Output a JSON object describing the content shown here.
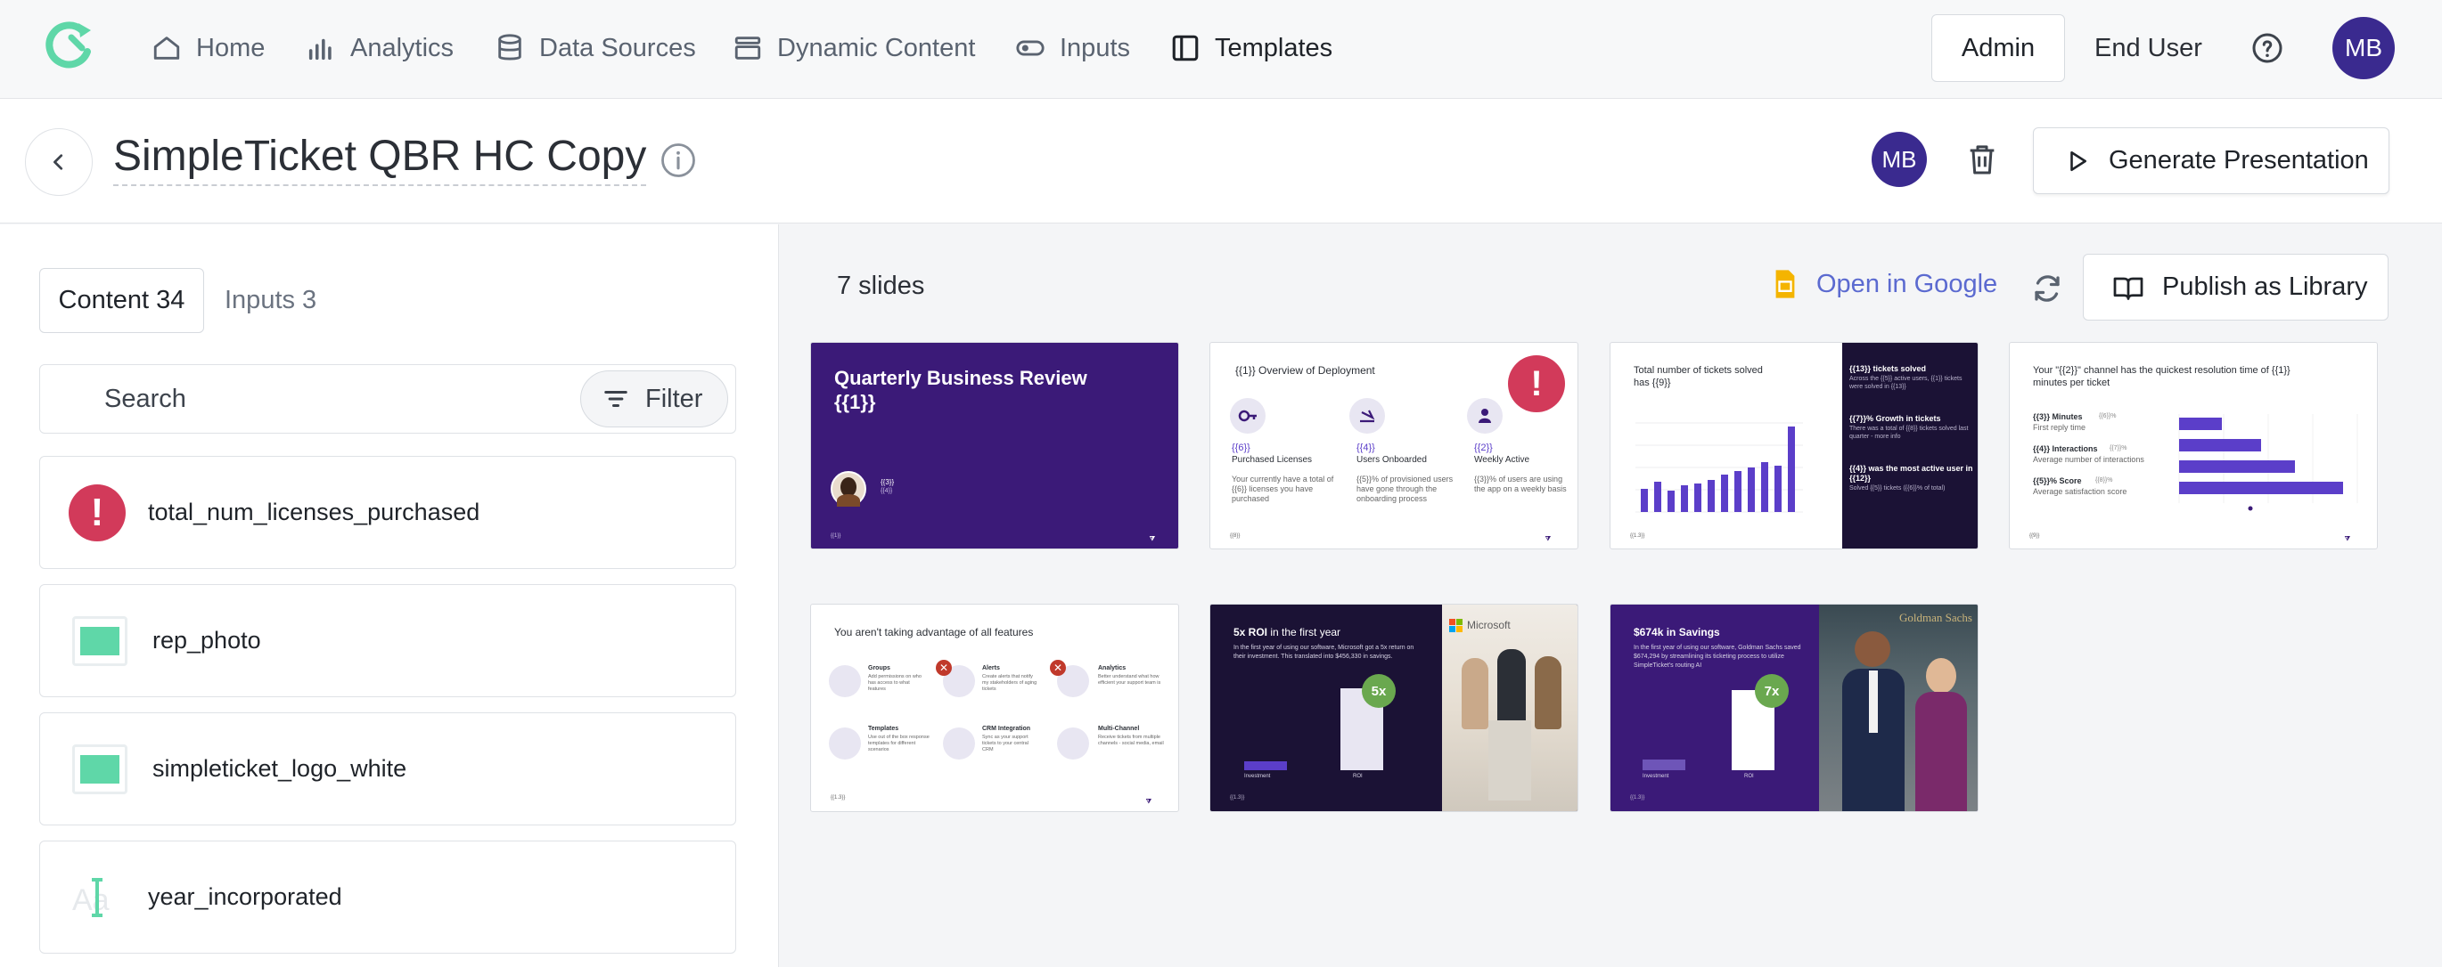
{
  "nav": {
    "items": [
      {
        "label": "Home",
        "icon": "home-icon"
      },
      {
        "label": "Analytics",
        "icon": "analytics-icon"
      },
      {
        "label": "Data Sources",
        "icon": "database-icon"
      },
      {
        "label": "Dynamic Content",
        "icon": "stack-icon"
      },
      {
        "label": "Inputs",
        "icon": "toggle-icon"
      },
      {
        "label": "Templates",
        "icon": "book-icon"
      }
    ],
    "admin_label": "Admin",
    "end_user_label": "End User",
    "avatar_initials": "MB"
  },
  "header": {
    "title": "SimpleTicket QBR HC Copy",
    "avatar_initials": "MB",
    "generate_label": "Generate Presentation"
  },
  "left": {
    "tabs": [
      {
        "label": "Content 34"
      },
      {
        "label": "Inputs 3"
      }
    ],
    "search": {
      "placeholder": "Search",
      "value": ""
    },
    "filter_label": "Filter",
    "items": [
      {
        "label": "total_num_licenses_purchased",
        "type": "alert"
      },
      {
        "label": "rep_photo",
        "type": "image"
      },
      {
        "label": "simpleticket_logo_white",
        "type": "image"
      },
      {
        "label": "year_incorporated",
        "type": "text"
      }
    ],
    "text_icon_glyph": "Aa"
  },
  "main": {
    "slides_count": "7 slides",
    "open_google_label": "Open in Google",
    "publish_label": "Publish as Library",
    "slides": [
      {
        "title": "Quarterly Business Review {{1}}",
        "sub1": "{{3}}",
        "sub2": "{{4}}",
        "footer": "{{1}}"
      },
      {
        "title": "{{1}} Overview of Deployment",
        "cols": [
          {
            "value": "{{6}}",
            "label": "Purchased Licenses",
            "desc": "Your currently have a total of {{6}} licenses you have purchased"
          },
          {
            "value": "{{4}}",
            "label": "Users Onboarded",
            "desc": "{{5}}% of provisioned users have gone through the onboarding process"
          },
          {
            "value": "{{2}}",
            "label": "Weekly Active",
            "desc": "{{3}}% of users are using the app on a weekly basis"
          }
        ],
        "footer": "{{8}}"
      },
      {
        "title": "Total number of tickets solved has {{9}}",
        "right": [
          {
            "head": "{{13}} tickets solved",
            "text": "Across the {{5}} active users, {{1}} tickets were solved in {{13}}"
          },
          {
            "head": "{{7}}% Growth in tickets",
            "text": "There was a total of {{8}} tickets solved last quarter - more info"
          },
          {
            "head": "{{4}} was the most active user in {{12}}",
            "text": "Solved {{5}} tickets ({{6}}% of total)"
          }
        ],
        "footer": "{{1.3}}"
      },
      {
        "title": "Your \"{{2}}\" channel has the quickest resolution time of {{1}} minutes per ticket",
        "stats": [
          {
            "head": "{{3}} Minutes",
            "tag": "{{6}}%",
            "text": "First reply time"
          },
          {
            "head": "{{4}} Interactions",
            "tag": "{{7}}%",
            "text": "Average number of interactions"
          },
          {
            "head": "{{5}}% Score",
            "tag": "{{8}}%",
            "text": "Average satisfaction score"
          }
        ],
        "footer": "{{9}}"
      },
      {
        "title": "You aren't taking advantage of all features",
        "features": [
          {
            "name": "Groups",
            "desc": "Add permissions on who has access to what features"
          },
          {
            "name": "Alerts",
            "desc": "Create alerts that notify my stakeholders of aging tickets"
          },
          {
            "name": "Analytics",
            "desc": "Better understand what how efficient your support team is"
          },
          {
            "name": "Templates",
            "desc": "Use out of the box response templates for different scenarios"
          },
          {
            "name": "CRM Integration",
            "desc": "Sync as your support tickets to your central CRM"
          },
          {
            "name": "Multi-Channel",
            "desc": "Receive tickets from multiple channels - social media, email"
          }
        ],
        "footer": "{{1.3}}"
      },
      {
        "title_bold": "5x ROI",
        "title_rest": " in the first year",
        "body": "In the first year of using our software, Microsoft got a 5x return on their investment. This translated into $456,330 in savings.",
        "badge": "5x",
        "bars": [
          "Investment",
          "ROI"
        ],
        "brand": "Microsoft",
        "footer": "{{1.3}}"
      },
      {
        "title": "$674k in Savings",
        "body": "In the first year of using our software, Goldman Sachs saved $674,294 by streamlining its ticketing process to utilize SimpleTicket's routing AI",
        "badge": "7x",
        "bars": [
          "Investment",
          "ROI"
        ],
        "brand": "Goldman Sachs",
        "footer": "{{1.3}}"
      }
    ]
  },
  "colors": {
    "accent": "#3a2a8f",
    "slide_purple": "#3b1a78",
    "link_blue": "#5b6ad0",
    "alert_red": "#d23a5a",
    "image_green": "#5fd7a8",
    "badge_green": "#6aa84f"
  }
}
